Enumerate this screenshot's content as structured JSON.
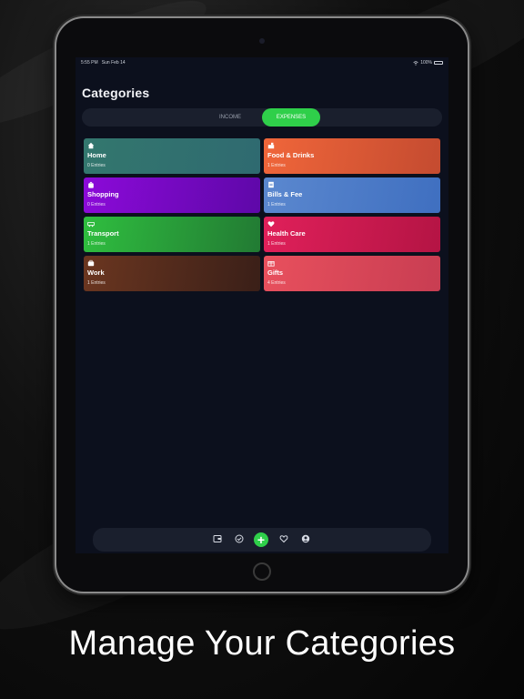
{
  "status_bar": {
    "time": "5:55 PM",
    "date": "Sun Feb 14",
    "battery": "100%"
  },
  "page_title": "Categories",
  "segment": {
    "income_label": "INCOME",
    "expenses_label": "EXPENSES",
    "selected": "EXPENSES"
  },
  "categories": [
    {
      "name": "Home",
      "entries": "0 Entries",
      "icon": "home-icon",
      "color_from": "#33776e",
      "color_to": "#2f6a70"
    },
    {
      "name": "Food & Drinks",
      "entries": "1 Entries",
      "icon": "food-icon",
      "color_from": "#f0663a",
      "color_to": "#c44b30"
    },
    {
      "name": "Shopping",
      "entries": "0 Entries",
      "icon": "shopping-bag-icon",
      "color_from": "#8c0ad9",
      "color_to": "#5e08a8"
    },
    {
      "name": "Bills & Fee",
      "entries": "1 Entries",
      "icon": "receipt-icon",
      "color_from": "#5b88cf",
      "color_to": "#3f6fc0"
    },
    {
      "name": "Transport",
      "entries": "1 Entries",
      "icon": "car-icon",
      "color_from": "#2fbe3f",
      "color_to": "#227a33"
    },
    {
      "name": "Health Care",
      "entries": "1 Entries",
      "icon": "heart-icon",
      "color_from": "#e0205a",
      "color_to": "#b41444"
    },
    {
      "name": "Work",
      "entries": "1 Entries",
      "icon": "briefcase-icon",
      "color_from": "#6b3620",
      "color_to": "#3a1f18"
    },
    {
      "name": "Gifts",
      "entries": "4 Entries",
      "icon": "gift-icon",
      "color_from": "#e8505d",
      "color_to": "#c83d52"
    }
  ],
  "tab_bar": {
    "items": [
      "wallet-icon",
      "check-circle-icon",
      "add-icon",
      "heart-outline-icon",
      "profile-icon"
    ]
  },
  "caption": "Manage Your Categories",
  "accent_color": "#2fcf4a"
}
